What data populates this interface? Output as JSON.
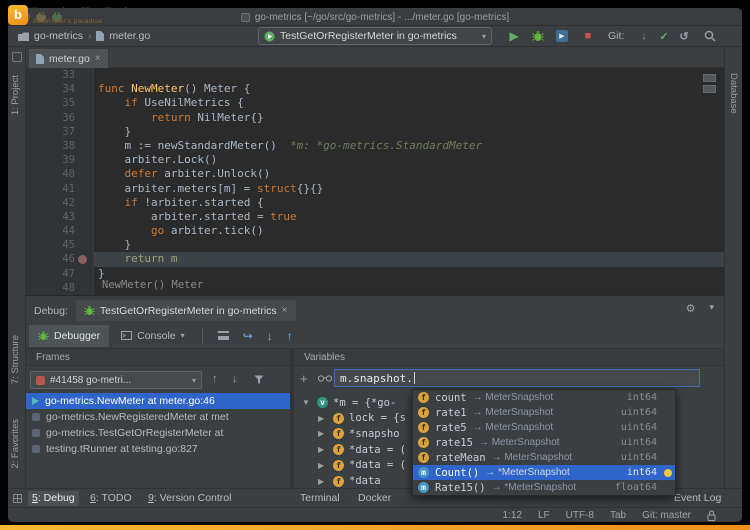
{
  "watermark": {
    "logo_letter": "b",
    "title": "DownloadDevTools.",
    "subtitle": "developer's paradise"
  },
  "title_bar": {
    "title": "go-metrics [~/go/src/go-metrics] - .../meter.go [go-metrics]"
  },
  "toolbar": {
    "breadcrumb": {
      "project": "go-metrics",
      "separator": "›",
      "file": "meter.go"
    },
    "run_config": {
      "label": "TestGetOrRegisterMeter in go-metrics"
    },
    "git_label": "Git:"
  },
  "editor": {
    "tab_label": "meter.go",
    "execution_line": 46,
    "breakpoint_line": 46,
    "footer_hint": "NewMeter() Meter",
    "lines": [
      {
        "n": 33,
        "tokens": []
      },
      {
        "n": 34,
        "tokens": [
          {
            "c": "kw",
            "t": "func "
          },
          {
            "c": "fn",
            "t": "NewMeter"
          },
          {
            "c": "pl",
            "t": "() Meter {"
          }
        ]
      },
      {
        "n": 35,
        "tokens": [
          {
            "c": "pl",
            "t": "    "
          },
          {
            "c": "kw",
            "t": "if"
          },
          {
            "c": "pl",
            "t": " UseNilMetrics {"
          }
        ]
      },
      {
        "n": 36,
        "tokens": [
          {
            "c": "pl",
            "t": "        "
          },
          {
            "c": "kw",
            "t": "return"
          },
          {
            "c": "pl",
            "t": " NilMeter{}"
          }
        ]
      },
      {
        "n": 37,
        "tokens": [
          {
            "c": "pl",
            "t": "    }"
          }
        ]
      },
      {
        "n": 38,
        "tokens": [
          {
            "c": "pl",
            "t": "    m := newStandardMeter()  "
          },
          {
            "c": "hint",
            "t": "*m: *go-metrics.StandardMeter"
          }
        ]
      },
      {
        "n": 39,
        "tokens": [
          {
            "c": "pl",
            "t": "    arbiter.Lock()"
          }
        ]
      },
      {
        "n": 40,
        "tokens": [
          {
            "c": "pl",
            "t": "    "
          },
          {
            "c": "kw",
            "t": "defer"
          },
          {
            "c": "pl",
            "t": " arbiter.Unlock()"
          }
        ]
      },
      {
        "n": 41,
        "tokens": [
          {
            "c": "pl",
            "t": "    arbiter.meters[m] = "
          },
          {
            "c": "kw",
            "t": "struct"
          },
          {
            "c": "pl",
            "t": "{}{}"
          }
        ]
      },
      {
        "n": 42,
        "tokens": [
          {
            "c": "pl",
            "t": "    "
          },
          {
            "c": "kw",
            "t": "if"
          },
          {
            "c": "pl",
            "t": " !arbiter.started {"
          }
        ]
      },
      {
        "n": 43,
        "tokens": [
          {
            "c": "pl",
            "t": "        arbiter.started = "
          },
          {
            "c": "kw",
            "t": "true"
          }
        ]
      },
      {
        "n": 44,
        "tokens": [
          {
            "c": "pl",
            "t": "        "
          },
          {
            "c": "kw",
            "t": "go"
          },
          {
            "c": "pl",
            "t": " arbiter.tick()"
          }
        ]
      },
      {
        "n": 45,
        "tokens": [
          {
            "c": "pl",
            "t": "    }"
          }
        ]
      },
      {
        "n": 46,
        "tokens": [
          {
            "c": "ret",
            "t": "    return m"
          }
        ]
      },
      {
        "n": 47,
        "tokens": [
          {
            "c": "pl",
            "t": "}"
          }
        ]
      },
      {
        "n": 48,
        "tokens": []
      }
    ]
  },
  "debug": {
    "label": "Debug:",
    "session_tab": "TestGetOrRegisterMeter in go-metrics",
    "tabs": {
      "debugger": "Debugger",
      "console": "Console"
    },
    "frames": {
      "title": "Frames",
      "thread_selector": "#41458 go-metri...",
      "items": [
        {
          "label": "go-metrics.NewMeter at meter.go:46",
          "selected": true
        },
        {
          "label": "go-metrics.NewRegisteredMeter at met",
          "selected": false
        },
        {
          "label": "go-metrics.TestGetOrRegisterMeter at",
          "selected": false
        },
        {
          "label": "testing.tRunner at testing.go:827",
          "selected": false
        }
      ]
    },
    "variables": {
      "title": "Variables",
      "watch_input": "m.snapshot.",
      "tree": [
        {
          "depth": 0,
          "expanded": true,
          "label": "*m = {*go-"
        },
        {
          "depth": 1,
          "expanded": false,
          "label": "lock = {s"
        },
        {
          "depth": 1,
          "expanded": false,
          "label": "*snapsho"
        },
        {
          "depth": 1,
          "expanded": false,
          "label": "*data = ("
        },
        {
          "depth": 1,
          "expanded": false,
          "label": "*data = ("
        },
        {
          "depth": 1,
          "expanded": false,
          "label": "*data"
        }
      ]
    }
  },
  "completion": {
    "items": [
      {
        "kind": "f",
        "name": "count",
        "arrow": "→",
        "type": "MeterSnapshot",
        "ret": "int64",
        "selected": false
      },
      {
        "kind": "f",
        "name": "rate1",
        "arrow": "→",
        "type": "MeterSnapshot",
        "ret": "uint64",
        "selected": false
      },
      {
        "kind": "f",
        "name": "rate5",
        "arrow": "→",
        "type": "MeterSnapshot",
        "ret": "uint64",
        "selected": false
      },
      {
        "kind": "f",
        "name": "rate15",
        "arrow": "→",
        "type": "MeterSnapshot",
        "ret": "uint64",
        "selected": false
      },
      {
        "kind": "f",
        "name": "rateMean",
        "arrow": "→",
        "type": "MeterSnapshot",
        "ret": "uint64",
        "selected": false
      },
      {
        "kind": "m",
        "name": "Count()",
        "arrow": "→",
        "type": "*MeterSnapshot",
        "ret": "int64",
        "selected": true
      },
      {
        "kind": "m",
        "name": "Rate15()",
        "arrow": "→",
        "type": "*MeterSnapshot",
        "ret": "float64",
        "selected": false
      }
    ]
  },
  "tool_strips": {
    "left": [
      "1: Project",
      "7: Structure",
      "2: Favorites"
    ],
    "right": [
      "Database"
    ]
  },
  "bottom_bar": {
    "items": [
      {
        "mnemonic": "5",
        "label": ": Debug",
        "active": true
      },
      {
        "mnemonic": "6",
        "label": ": TODO",
        "active": false
      },
      {
        "mnemonic": "9",
        "label": ": Version Control",
        "active": false
      },
      {
        "mnemonic": "",
        "label": "Terminal",
        "active": false
      },
      {
        "mnemonic": "",
        "label": "Docker",
        "active": false
      },
      {
        "mnemonic": "",
        "label": "Event Log",
        "active": false
      }
    ]
  },
  "status_bar": {
    "position": "1:12",
    "line_ending": "LF",
    "encoding": "UTF-8",
    "indent": "Tab",
    "git": "Git: master"
  }
}
